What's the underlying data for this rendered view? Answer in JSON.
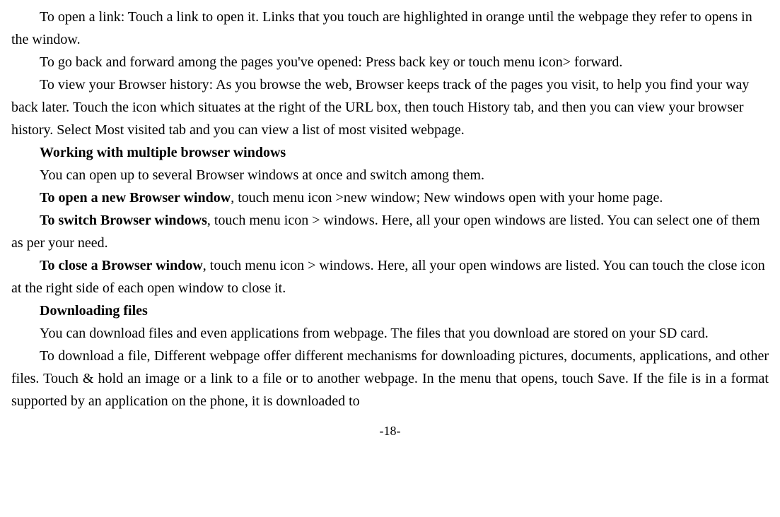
{
  "paragraphs": {
    "p1": "To open a link: Touch a link to open it. Links that you touch are highlighted in orange until the webpage they refer to opens in the window.",
    "p2": "To go back and forward among the pages you've opened: Press back key or touch menu icon> forward.",
    "p3": "To view your Browser history: As you browse the web, Browser keeps track of the pages you visit, to help you find your way back later. Touch the icon which situates at the right of the URL box, then touch History tab, and then you can view your browser history. Select Most visited tab and you can view a list of most visited webpage.",
    "h1": "Working with multiple browser windows",
    "p4": "You can open up to several Browser windows at once and switch among them.",
    "p5_bold": "To open a new Browser window",
    "p5_rest": ", touch menu icon >new window; New windows open with your home page.",
    "p6_bold": "To switch Browser windows",
    "p6_rest": ", touch menu icon > windows. Here, all your open windows are listed. You can select one of them as per your need.",
    "p7_bold": "To close a Browser window",
    "p7_rest": ", touch menu icon > windows. Here, all your open windows are listed. You can touch the close icon at the right side of each open window to close it.",
    "h2": "Downloading files",
    "p8": "You can download files and even applications from webpage. The files that you download are stored on your SD card.",
    "p9": "To download a file, Different webpage offer different mechanisms for downloading pictures, documents, applications, and other files. Touch & hold an image or a link to a file or to another webpage. In the menu that opens, touch Save. If the file is in a format supported by an application on the phone, it is downloaded to"
  },
  "pageNumber": "-18-"
}
